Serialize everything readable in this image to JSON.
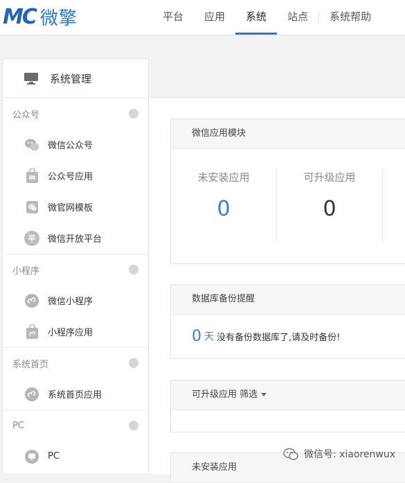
{
  "header": {
    "logo_mark": "MC",
    "logo_text": "微擎",
    "nav": [
      {
        "label": "平台"
      },
      {
        "label": "应用"
      },
      {
        "label": "系统"
      },
      {
        "label": "站点"
      },
      {
        "label": "系统帮助"
      }
    ],
    "active_nav": "系统"
  },
  "sidebar": {
    "title": "系统管理",
    "groups": [
      {
        "title": "公众号",
        "items": [
          {
            "label": "微信公众号",
            "icon": "wechat-icon"
          },
          {
            "label": "公众号应用",
            "icon": "app-bag-icon"
          },
          {
            "label": "微官网模板",
            "icon": "template-icon"
          },
          {
            "label": "微信开放平台",
            "icon": "platform-icon",
            "glyph": "平"
          }
        ]
      },
      {
        "title": "小程序",
        "items": [
          {
            "label": "微信小程序",
            "icon": "miniprogram-icon"
          },
          {
            "label": "小程序应用",
            "icon": "miniprogram-app-icon"
          }
        ]
      },
      {
        "title": "系统首页",
        "items": [
          {
            "label": "系统首页应用",
            "icon": "home-app-icon"
          }
        ]
      },
      {
        "title": "PC",
        "items": [
          {
            "label": "PC",
            "icon": "pc-icon"
          }
        ]
      }
    ]
  },
  "main": {
    "module_panel": {
      "title": "微信应用模块",
      "stats": [
        {
          "label": "未安装应用",
          "value": "0",
          "color": "#3b7fc4"
        },
        {
          "label": "可升级应用",
          "value": "0",
          "color": "#333333"
        }
      ]
    },
    "backup_panel": {
      "title": "数据库备份提醒",
      "days": "0",
      "unit": "天",
      "message": "没有备份数据库了,请及时备份!"
    },
    "upgrade_panel": {
      "title": "可升级应用",
      "filter_label": "筛选"
    },
    "uninstalled_panel": {
      "title": "未安装应用"
    }
  },
  "watermark": {
    "text": "微信号: xiaorenwux"
  },
  "colors": {
    "accent": "#2f77c9",
    "stat_blue": "#3b7fc4"
  }
}
